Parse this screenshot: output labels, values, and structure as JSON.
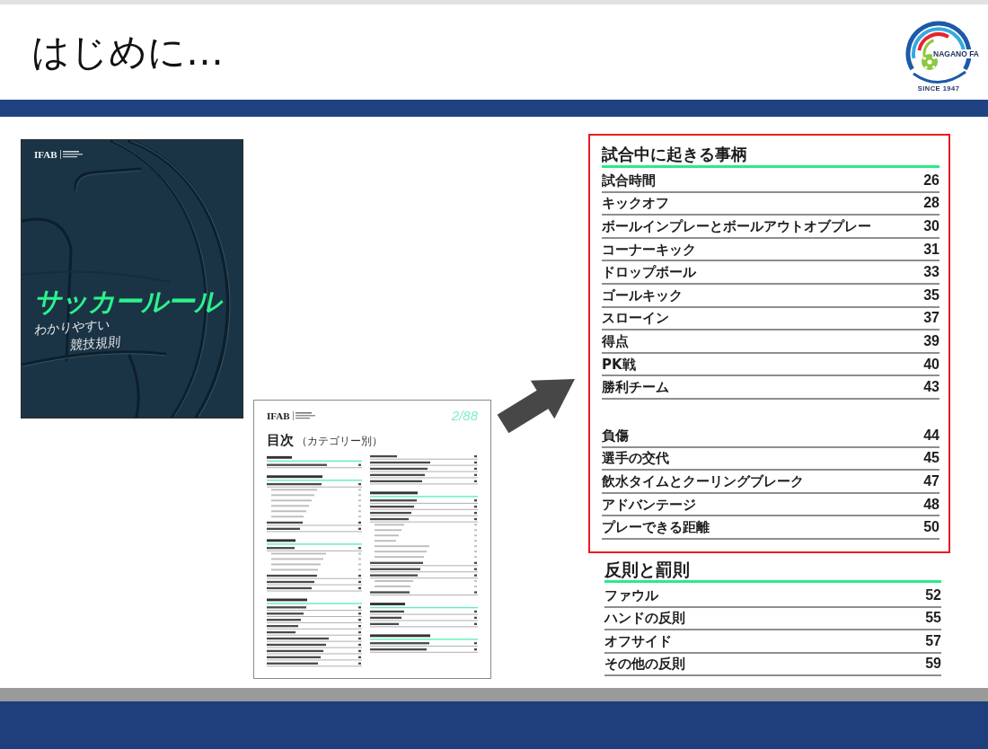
{
  "header": {
    "title": "はじめに…",
    "logo": {
      "name": "NAGANO FA",
      "since": "SINCE 1947"
    }
  },
  "book_cover": {
    "publisher": "IFAB",
    "title": "サッカールール",
    "subtitle": [
      "わかりやすい",
      "競技規則"
    ]
  },
  "contents_page": {
    "publisher": "IFAB",
    "page_number": "2/88",
    "heading": "目次",
    "subheading": "（カテゴリー別）"
  },
  "contents_detail": {
    "sections": [
      {
        "title": "試合中に起きる事柄",
        "highlighted": true,
        "groups": [
          {
            "rows": [
              {
                "label": "試合時間",
                "page": "26"
              },
              {
                "label": "キックオフ",
                "page": "28"
              },
              {
                "label": "ボールインプレーとボールアウトオブプレー",
                "page": "30"
              },
              {
                "label": "コーナーキック",
                "page": "31"
              },
              {
                "label": "ドロップボール",
                "page": "33"
              },
              {
                "label": "ゴールキック",
                "page": "35"
              },
              {
                "label": "スローイン",
                "page": "37"
              },
              {
                "label": "得点",
                "page": "39"
              },
              {
                "label": "PK戦",
                "page": "40"
              },
              {
                "label": "勝利チーム",
                "page": "43"
              }
            ]
          },
          {
            "rows": [
              {
                "label": "負傷",
                "page": "44"
              },
              {
                "label": "選手の交代",
                "page": "45"
              },
              {
                "label": "飲水タイムとクーリングブレーク",
                "page": "47"
              },
              {
                "label": "アドバンテージ",
                "page": "48"
              },
              {
                "label": "プレーできる距離",
                "page": "50"
              }
            ]
          }
        ]
      },
      {
        "title": "反則と罰則",
        "highlighted": false,
        "groups": [
          {
            "rows": [
              {
                "label": "ファウル",
                "page": "52"
              },
              {
                "label": "ハンドの反則",
                "page": "55"
              },
              {
                "label": "オフサイド",
                "page": "57"
              },
              {
                "label": "その他の反則",
                "page": "59"
              }
            ]
          }
        ]
      }
    ]
  }
}
